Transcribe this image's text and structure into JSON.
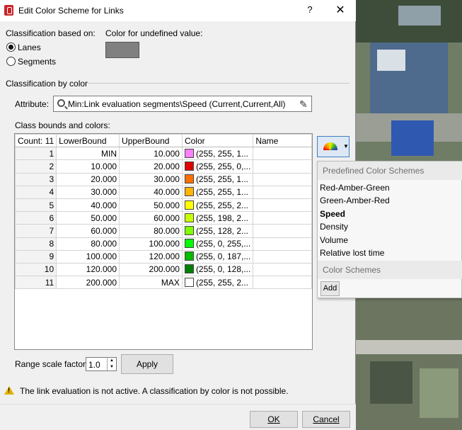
{
  "window": {
    "title": "Edit Color Scheme for Links",
    "help": "?",
    "close": "✕"
  },
  "classification": {
    "label": "Classification based on:",
    "options": [
      {
        "label": "Lanes",
        "selected": true
      },
      {
        "label": "Segments",
        "selected": false
      }
    ]
  },
  "undefined_color": {
    "label": "Color for undefined value:",
    "color": "#808080"
  },
  "by_color": {
    "section_label": "Classification by color",
    "attribute_label": "Attribute:",
    "attribute_value": "Min:Link evaluation segments\\Speed (Current,Current,All)"
  },
  "table": {
    "caption": "Class bounds and colors:",
    "headers": [
      "Count: 11",
      "LowerBound",
      "UpperBound",
      "Color",
      "Name"
    ],
    "rows": [
      {
        "idx": "1",
        "lower": "MIN",
        "upper": "10.000",
        "color_hex": "#ff80ff",
        "color_text": "(255, 255, 1...",
        "name": ""
      },
      {
        "idx": "2",
        "lower": "10.000",
        "upper": "20.000",
        "color_hex": "#e00000",
        "color_text": "(255, 255, 0,...",
        "name": ""
      },
      {
        "idx": "3",
        "lower": "20.000",
        "upper": "30.000",
        "color_hex": "#ff7000",
        "color_text": "(255, 255, 1...",
        "name": ""
      },
      {
        "idx": "4",
        "lower": "30.000",
        "upper": "40.000",
        "color_hex": "#ffb400",
        "color_text": "(255, 255, 1...",
        "name": ""
      },
      {
        "idx": "5",
        "lower": "40.000",
        "upper": "50.000",
        "color_hex": "#ffff00",
        "color_text": "(255, 255, 2...",
        "name": ""
      },
      {
        "idx": "6",
        "lower": "50.000",
        "upper": "60.000",
        "color_hex": "#c6ff00",
        "color_text": "(255, 198, 2...",
        "name": ""
      },
      {
        "idx": "7",
        "lower": "60.000",
        "upper": "80.000",
        "color_hex": "#80ff00",
        "color_text": "(255, 128, 2...",
        "name": ""
      },
      {
        "idx": "8",
        "lower": "80.000",
        "upper": "100.000",
        "color_hex": "#00ff00",
        "color_text": "(255, 0, 255,...",
        "name": ""
      },
      {
        "idx": "9",
        "lower": "100.000",
        "upper": "120.000",
        "color_hex": "#00bb00",
        "color_text": "(255, 0, 187,...",
        "name": ""
      },
      {
        "idx": "10",
        "lower": "120.000",
        "upper": "200.000",
        "color_hex": "#008000",
        "color_text": "(255, 0, 128,...",
        "name": ""
      },
      {
        "idx": "11",
        "lower": "200.000",
        "upper": "MAX",
        "color_hex": "#ffffff",
        "color_text": "(255, 255, 2...",
        "name": ""
      }
    ]
  },
  "scheme_menu": {
    "predefined_header": "Predefined Color Schemes",
    "predefined": [
      "Red-Amber-Green",
      "Green-Amber-Red",
      "Speed",
      "Density",
      "Volume",
      "Relative lost time"
    ],
    "selected": "Speed",
    "schemes_header": "Color Schemes",
    "add_label": "Add"
  },
  "range": {
    "label": "Range scale factor:",
    "value": "1.0",
    "apply_label": "Apply"
  },
  "warning": "The link evaluation is not active. A classification by color is not possible.",
  "buttons": {
    "ok": "OK",
    "cancel": "Cancel"
  }
}
